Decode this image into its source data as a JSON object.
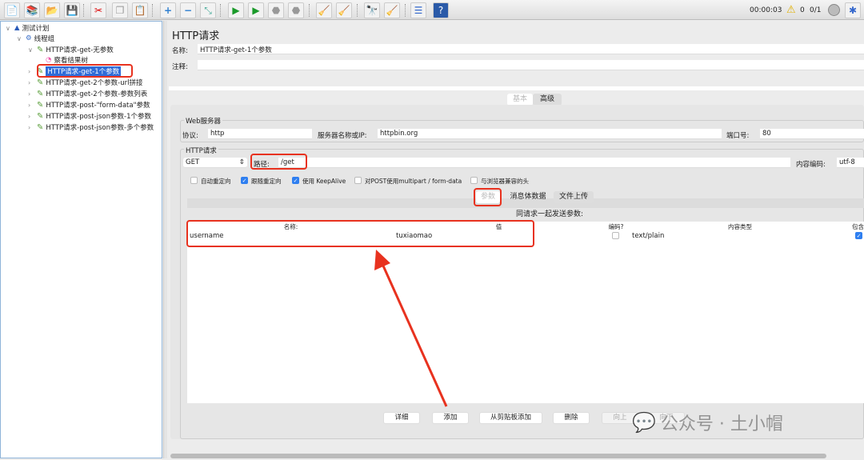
{
  "toolbar": {
    "icons": [
      "new-icon",
      "templates-icon",
      "open-icon",
      "save-icon",
      "cut-icon",
      "copy-icon",
      "paste-icon",
      "expand-icon",
      "collapse-icon",
      "toggle-icon",
      "start-icon",
      "start-no-pause-icon",
      "stop-icon",
      "shutdown-icon",
      "clear-icon",
      "clear-all-icon",
      "search-icon",
      "reset-search-icon",
      "function-helper-icon",
      "help-icon"
    ],
    "timer": "00:00:03",
    "warnings": "0",
    "threads": "0/1"
  },
  "tree": {
    "root": "测试计划",
    "thread_group": "线程组",
    "items": [
      "HTTP请求-get-无参数",
      "察看结果树",
      "HTTP请求-get-1个参数",
      "HTTP请求-get-2个参数-url拼接",
      "HTTP请求-get-2个参数-参数列表",
      "HTTP请求-post-\"form-data\"参数",
      "HTTP请求-post-json参数-1个参数",
      "HTTP请求-post-json参数-多个参数"
    ],
    "selected": "HTTP请求-get-1个参数"
  },
  "main": {
    "title": "HTTP请求",
    "name_label": "名称:",
    "name_value": "HTTP请求-get-1个参数",
    "comment_label": "注释:",
    "comment_value": "",
    "tabs": [
      "基本",
      "高级"
    ],
    "web_server": {
      "legend": "Web服务器",
      "protocol_label": "协议:",
      "protocol": "http",
      "server_label": "服务器名称或IP:",
      "server": "httpbin.org",
      "port_label": "端口号:",
      "port": "80"
    },
    "http_request": {
      "legend": "HTTP请求",
      "method": "GET",
      "path_label": "路径:",
      "path": "/get",
      "encoding_label": "内容编码:",
      "encoding": "utf-8",
      "options": [
        {
          "label": "自动重定向",
          "checked": false
        },
        {
          "label": "跟随重定向",
          "checked": true
        },
        {
          "label": "使用 KeepAlive",
          "checked": true
        },
        {
          "label": "对POST使用multipart / form-data",
          "checked": false
        },
        {
          "label": "与浏览器兼容的头",
          "checked": false
        }
      ]
    },
    "sub_tabs": [
      "参数",
      "消息体数据",
      "文件上传"
    ],
    "params_title": "同请求一起发送参数:",
    "columns": [
      "名称:",
      "值",
      "编码?",
      "内容类型",
      "包含等于?"
    ],
    "rows": [
      {
        "name": "username",
        "value": "tuxiaomao",
        "encode": false,
        "content_type": "text/plain",
        "include_equals": true
      }
    ],
    "buttons": [
      "详细",
      "添加",
      "从剪贴板添加",
      "删除",
      "向上",
      "向下"
    ]
  },
  "watermark": "公众号 · 土小帽",
  "colors": {
    "selection": "#2f6bd8",
    "annotation": "#e8321f",
    "check": "#2f7ff0"
  }
}
